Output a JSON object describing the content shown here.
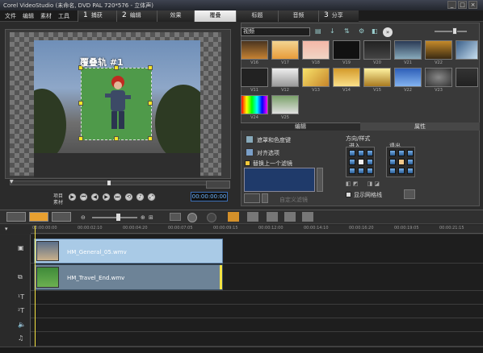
{
  "window": {
    "title": "Corel VideoStudio (未命名, DVD PAL 720*576 - 立体声)",
    "min": "_",
    "max": "□",
    "close": "×"
  },
  "menu": [
    "文件",
    "编辑",
    "素材",
    "工具"
  ],
  "steps": [
    {
      "num": "1",
      "label": "捕获"
    },
    {
      "num": "2",
      "label": "编辑"
    },
    {
      "num": "",
      "label": "效果"
    },
    {
      "num": "",
      "label": "覆叠"
    },
    {
      "num": "",
      "label": "标题"
    },
    {
      "num": "",
      "label": "音频"
    },
    {
      "num": "3",
      "label": "分享"
    }
  ],
  "preview": {
    "overlay_label": "覆叠轨 #1",
    "project_label": "项目",
    "clip_label": "素材",
    "timecode": "00:00:00:00"
  },
  "library": {
    "dropdown": "视频",
    "thumb_labels": [
      "V16",
      "V17",
      "V18",
      "V19",
      "V20",
      "V21",
      "V22",
      "V11",
      "V12",
      "V13",
      "V14",
      "V15",
      "V22",
      "V23",
      "V24",
      "V25"
    ]
  },
  "panel": {
    "tabs": [
      "编辑",
      "属性"
    ],
    "mask_chroma": "遮罩和色度键",
    "align_options": "对齐选项",
    "replace_filter": "替换上一个滤镜",
    "custom_filter": "自定义滤镜",
    "direction_style": "方向/样式",
    "enter": "进入",
    "exit": "退出",
    "show_grid": "显示网格线"
  },
  "ruler": [
    "00:00:00:00",
    "00:00:02:10",
    "00:00:04:20",
    "00:00:07:05",
    "00:00:09:15",
    "00:00:12:00",
    "00:00:14:10",
    "00:00:16:20",
    "00:00:19:05",
    "00:00:21:15"
  ],
  "timeline": {
    "clips": [
      {
        "name": "HM_General_05.wmv"
      },
      {
        "name": "HM_Travel_End.wmv"
      }
    ],
    "track_icons": [
      "video-track-icon",
      "overlay-track-icon",
      "title-track-1-icon",
      "title-track-2-icon",
      "voice-track-icon",
      "music-track-icon"
    ],
    "track_glyphs": [
      "▣",
      "⧉",
      "¹T",
      "²T",
      "🔈",
      "♫"
    ]
  },
  "colors": {
    "accent": "#6fb6ff",
    "playhead": "#f4e342",
    "clip_blue": "#a9cae6"
  }
}
